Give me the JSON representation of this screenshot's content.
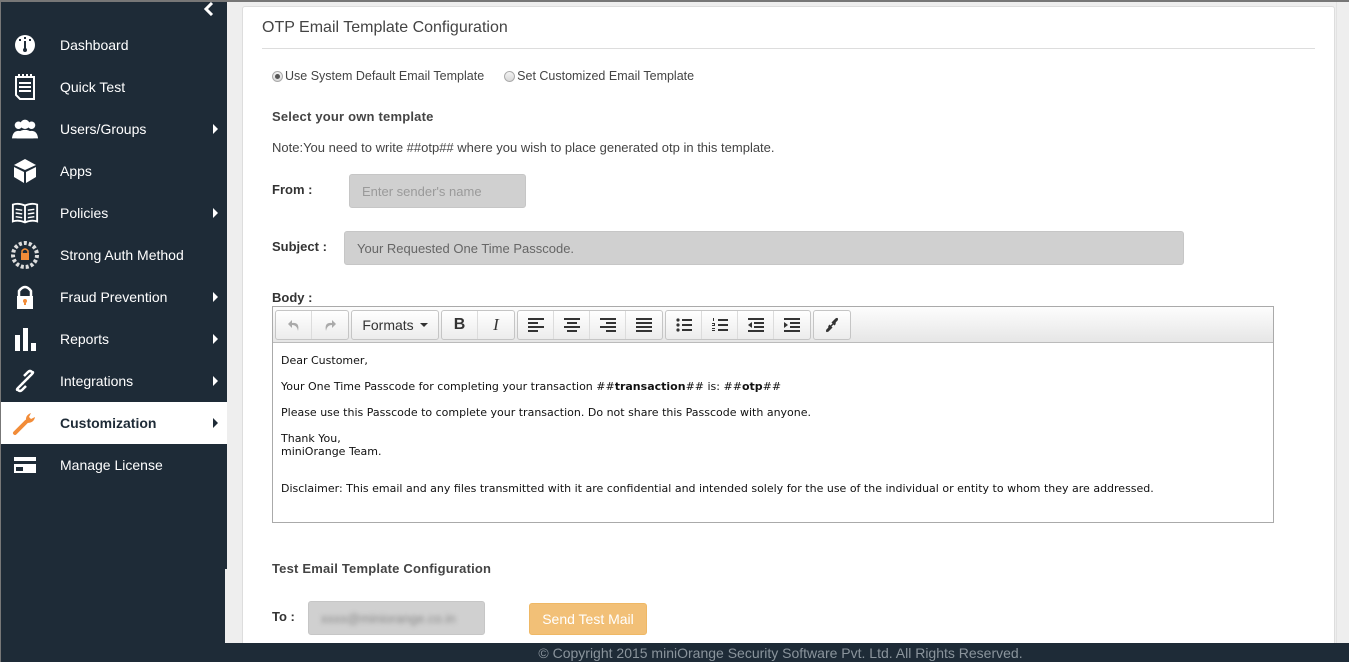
{
  "sidebar": {
    "collapse_icon": "chevron-left-icon",
    "items": [
      {
        "label": "Dashboard",
        "icon": "dashboard-gauge-icon",
        "has_submenu": false,
        "active": false
      },
      {
        "label": "Quick Test",
        "icon": "notepad-icon",
        "has_submenu": false,
        "active": false
      },
      {
        "label": "Users/Groups",
        "icon": "users-icon",
        "has_submenu": true,
        "active": false
      },
      {
        "label": "Apps",
        "icon": "cube-icon",
        "has_submenu": false,
        "active": false
      },
      {
        "label": "Policies",
        "icon": "book-icon",
        "has_submenu": true,
        "active": false
      },
      {
        "label": "Strong Auth Method",
        "icon": "auth-lock-icon",
        "has_submenu": false,
        "active": false
      },
      {
        "label": "Fraud Prevention",
        "icon": "padlock-icon",
        "has_submenu": true,
        "active": false
      },
      {
        "label": "Reports",
        "icon": "bar-chart-icon",
        "has_submenu": true,
        "active": false
      },
      {
        "label": "Integrations",
        "icon": "link-icon",
        "has_submenu": true,
        "active": false
      },
      {
        "label": "Customization",
        "icon": "wrench-icon",
        "has_submenu": true,
        "active": true
      },
      {
        "label": "Manage License",
        "icon": "credit-card-icon",
        "has_submenu": false,
        "active": false
      }
    ]
  },
  "main": {
    "title": "OTP Email Template Configuration",
    "template_options": [
      {
        "label": "Use System Default Email Template",
        "checked": true
      },
      {
        "label": "Set Customized Email Template",
        "checked": false
      }
    ],
    "select_heading": "Select your own template",
    "note": "Note:You need to write ##otp## where you wish to place generated otp in this template.",
    "from": {
      "label": "From :",
      "value": "",
      "placeholder": "Enter sender's name"
    },
    "subject": {
      "label": "Subject :",
      "value": "Your Requested One Time Passcode."
    },
    "body": {
      "label": "Body :",
      "toolbar": {
        "undo": "undo-icon",
        "redo": "redo-icon",
        "formats_label": "Formats",
        "bold": "bold-icon",
        "italic": "italic-icon",
        "align_left": "align-left-icon",
        "align_center": "align-center-icon",
        "align_right": "align-right-icon",
        "align_justify": "align-justify-icon",
        "bullet_list": "bullet-list-icon",
        "numbered_list": "numbered-list-icon",
        "outdent": "outdent-icon",
        "indent": "indent-icon",
        "link": "link-icon"
      },
      "content": {
        "greeting": "Dear Customer,",
        "line1_prefix": "Your One Time Passcode for completing your transaction ",
        "line1_tx_hash_open": "##",
        "line1_tx_word": "transaction",
        "line1_tx_hash_close": "##",
        "line1_middle": " is: ",
        "line1_otp_hash_open": "##",
        "line1_otp_word": "otp",
        "line1_otp_hash_close": "##",
        "line2": "Please use this Passcode to complete your transaction. Do not share this Passcode with anyone.",
        "signoff1": "Thank You,",
        "signoff2": "miniOrange Team.",
        "disclaimer": "Disclaimer: This email and any files transmitted with it are confidential and intended solely for the use of the individual or entity to whom they are addressed."
      }
    },
    "test_section": {
      "heading": "Test Email Template Configuration",
      "to_label": "To :",
      "to_value": "xxxx@miniorange.co.in",
      "send_button": "Send Test Mail"
    }
  },
  "footer": {
    "copyright": "© Copyright 2015 miniOrange Security Software Pvt. Ltd. All Rights Reserved."
  },
  "colors": {
    "sidebar_bg": "#1e2b37",
    "accent_orange": "#f28c38",
    "send_button_bg": "#f2c077"
  }
}
